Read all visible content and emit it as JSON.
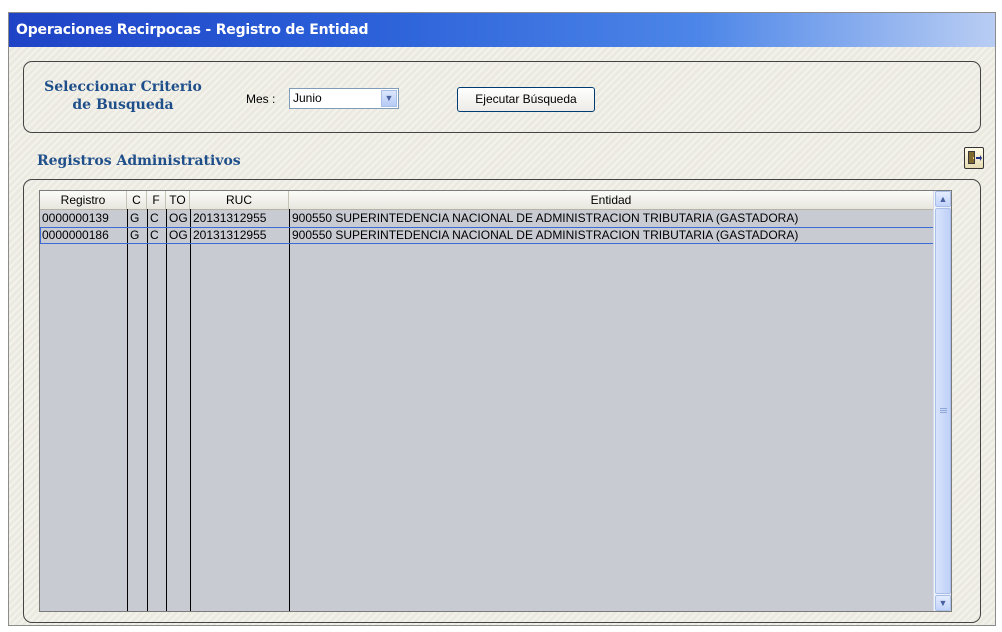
{
  "window": {
    "title": "Operaciones Recirpocas - Registro de Entidad"
  },
  "criteria": {
    "title": "Seleccionar Criterio de Busqueda",
    "month_label": "Mes :",
    "month_value": "Junio",
    "run_button": "Ejecutar Búsqueda"
  },
  "records": {
    "title": "Registros Administrativos",
    "columns": [
      "Registro",
      "C",
      "F",
      "TO",
      "RUC",
      "Entidad"
    ],
    "rows": [
      [
        "0000000139",
        "G",
        "C",
        "OG",
        "20131312955",
        "900550  SUPERINTEDENCIA NACIONAL DE ADMINISTRACION TRIBUTARIA (GASTADORA)"
      ],
      [
        "0000000186",
        "G",
        "C",
        "OG",
        "20131312955",
        "900550  SUPERINTEDENCIA NACIONAL DE ADMINISTRACION TRIBUTARIA (GASTADORA)"
      ]
    ]
  },
  "icons": {
    "exit": "exit-door-icon",
    "dropdown": "chevron-down-icon",
    "scroll_up": "scroll-up-arrow-icon",
    "scroll_down": "scroll-down-arrow-icon"
  }
}
